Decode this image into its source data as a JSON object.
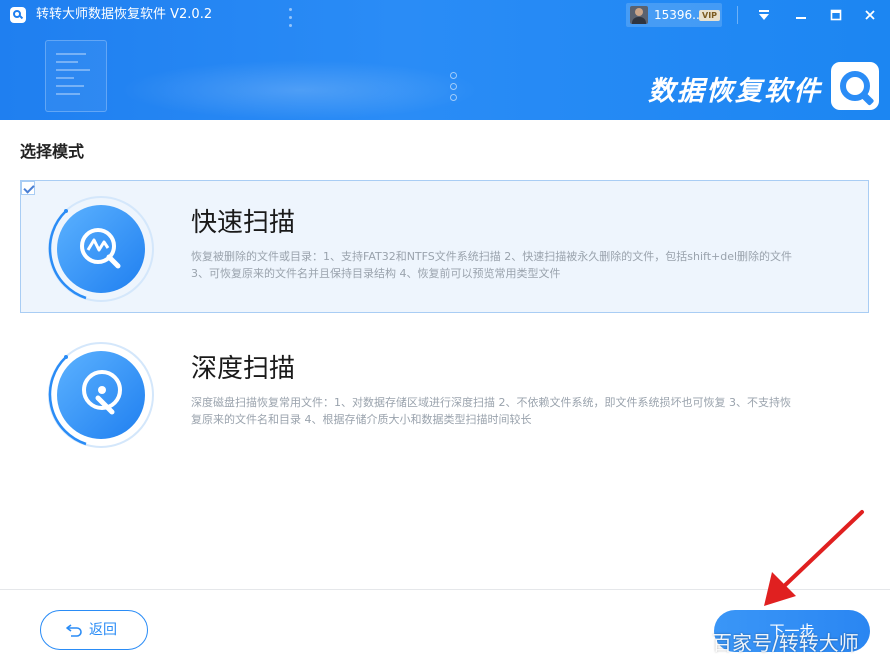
{
  "app": {
    "title": "转转大师数据恢复软件 V2.0.2",
    "user_name": "15396...",
    "vip_badge": "VIP",
    "brand_text": "数据恢复软件"
  },
  "window_controls": {
    "menu_icon": "dropdown-triangle-icon",
    "minimize_icon": "minimize-icon",
    "maximize_icon": "maximize-icon",
    "close_icon": "close-icon"
  },
  "section_title": "选择模式",
  "options": [
    {
      "title": "快速扫描",
      "description": "恢复被删除的文件或目录：1、支持FAT32和NTFS文件系统扫描 2、快速扫描被永久删除的文件，包括shift+del删除的文件 3、可恢复原来的文件名并且保持目录结构 4、恢复前可以预览常用类型文件",
      "selected": true,
      "icon": "chart-magnifier-icon"
    },
    {
      "title": "深度扫描",
      "description": "深度磁盘扫描恢复常用文件：1、对数据存储区域进行深度扫描 2、不依赖文件系统，即文件系统损坏也可恢复 3、不支持恢复原来的文件名和目录 4、根据存储介质大小和数据类型扫描时间较长",
      "selected": false,
      "icon": "disk-probe-icon"
    }
  ],
  "footer": {
    "back_label": "返回",
    "next_label": "下一步",
    "watermark": "百家号/转转大师"
  },
  "colors": {
    "accent": "#2a8cf6",
    "selected_bg": "#eef5fd",
    "annotation_arrow": "#e02020"
  }
}
